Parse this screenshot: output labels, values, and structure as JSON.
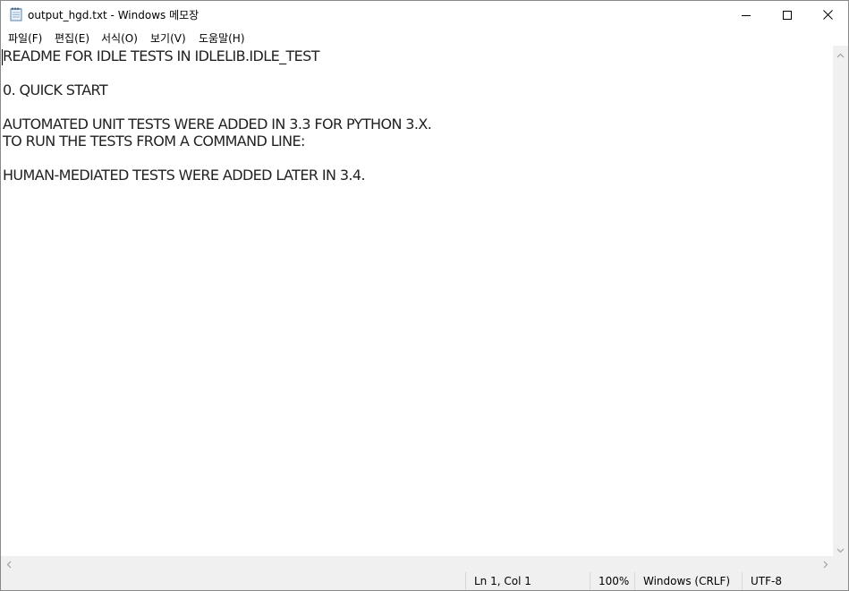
{
  "window": {
    "title": "output_hgd.txt - Windows 메모장"
  },
  "menu": [
    {
      "label": "파일(F)"
    },
    {
      "label": "편집(E)"
    },
    {
      "label": "서식(O)"
    },
    {
      "label": "보기(V)"
    },
    {
      "label": "도움말(H)"
    }
  ],
  "editor": {
    "lines": [
      "README FOR IDLE TESTS IN IDLELIB.IDLE_TEST",
      "",
      "0. QUICK START",
      "",
      "AUTOMATED UNIT TESTS WERE ADDED IN 3.3 FOR PYTHON 3.X.",
      "TO RUN THE TESTS FROM A COMMAND LINE:",
      "",
      "HUMAN-MEDIATED TESTS WERE ADDED LATER IN 3.4."
    ]
  },
  "status": {
    "position": "Ln 1, Col 1",
    "zoom": "100%",
    "line_ending": "Windows (CRLF)",
    "encoding": "UTF-8"
  },
  "icons": {
    "app": "notepad-icon",
    "minimize": "minimize-icon",
    "maximize": "maximize-icon",
    "close": "close-icon"
  }
}
